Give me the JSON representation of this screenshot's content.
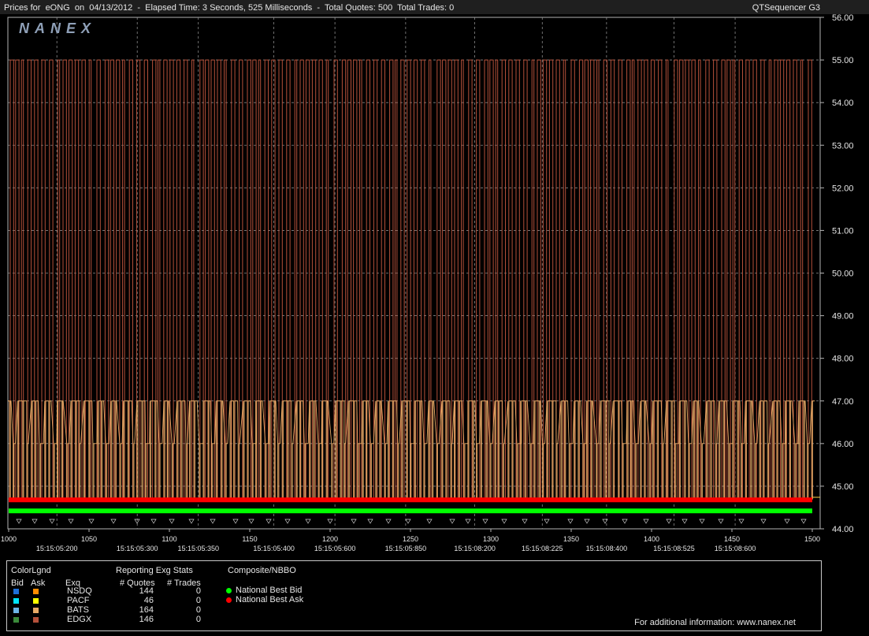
{
  "header": {
    "title": "Prices for  eONG  on  04/13/2012  -  Elapsed Time: 3 Seconds, 525 Milliseconds  -  Total Quotes: 500  Total Trades: 0",
    "app": "QTSequencer G3"
  },
  "logo": "NANEX",
  "colors": {
    "background": "#000000",
    "plot_border": "#b4b4b4",
    "grid": "#8a8a8a",
    "ask_edgx": "#b4503a",
    "ask_bats": "#e8aa66",
    "national_best_bid": "#00ff00",
    "national_best_ask": "#ff0000"
  },
  "chart_data": {
    "type": "line",
    "xlim": [
      1000,
      1500
    ],
    "ylim": [
      44.0,
      56.0
    ],
    "x_ticks": [
      1000,
      1050,
      1100,
      1150,
      1200,
      1250,
      1300,
      1350,
      1400,
      1450,
      1500
    ],
    "y_ticks": [
      "44.00",
      "45.00",
      "46.00",
      "47.00",
      "48.00",
      "49.00",
      "50.00",
      "51.00",
      "52.00",
      "53.00",
      "54.00",
      "55.00",
      "56.00"
    ],
    "time_labels": [
      {
        "seq": 1030,
        "label": "15:15:05:200"
      },
      {
        "seq": 1080,
        "label": "15:15:05:300"
      },
      {
        "seq": 1118,
        "label": "15:15:05:350"
      },
      {
        "seq": 1165,
        "label": "15:15:05:400"
      },
      {
        "seq": 1203,
        "label": "15:15:05:600"
      },
      {
        "seq": 1247,
        "label": "15:15:05:850"
      },
      {
        "seq": 1290,
        "label": "15:15:08:200"
      },
      {
        "seq": 1332,
        "label": "15:15:08:225"
      },
      {
        "seq": 1372,
        "label": "15:15:08:400"
      },
      {
        "seq": 1414,
        "label": "15:15:08:525"
      },
      {
        "seq": 1452,
        "label": "15:15:08:600"
      }
    ],
    "series": [
      {
        "name": "EDGX Ask",
        "levels": [
          55.0,
          44.7
        ],
        "high_every": 4
      },
      {
        "name": "BATS Ask",
        "levels": [
          47.0,
          46.0,
          44.7
        ]
      },
      {
        "name": "National Best Bid",
        "values_constant": 44.42
      },
      {
        "name": "National Best Ask",
        "values_constant": 44.68
      }
    ]
  },
  "legend": {
    "colorlgnd": "ColorLgnd",
    "bid": "Bid",
    "ask": "Ask",
    "exq": "Exq",
    "stats_title": "Reporting Exg Stats",
    "quotes_h": "# Quotes",
    "trades_h": "# Trades",
    "composite_title": "Composite/NBBO",
    "rows": [
      {
        "exg": "NSDQ",
        "bid_color": "#1e6fd8",
        "ask_color": "#ff8c00",
        "quotes": "144",
        "trades": "0"
      },
      {
        "exg": "PACF",
        "bid_color": "#00e5ff",
        "ask_color": "#ffff00",
        "quotes": "46",
        "trades": "0"
      },
      {
        "exg": "BATS",
        "bid_color": "#6cb4e6",
        "ask_color": "#e8aa66",
        "quotes": "164",
        "trades": "0"
      },
      {
        "exg": "EDGX",
        "bid_color": "#3a8a3a",
        "ask_color": "#b4503a",
        "quotes": "146",
        "trades": "0"
      }
    ],
    "nbb_label": "National Best Bid",
    "nba_label": "National Best Ask",
    "footer": "For additional information: www.nanex.net"
  }
}
